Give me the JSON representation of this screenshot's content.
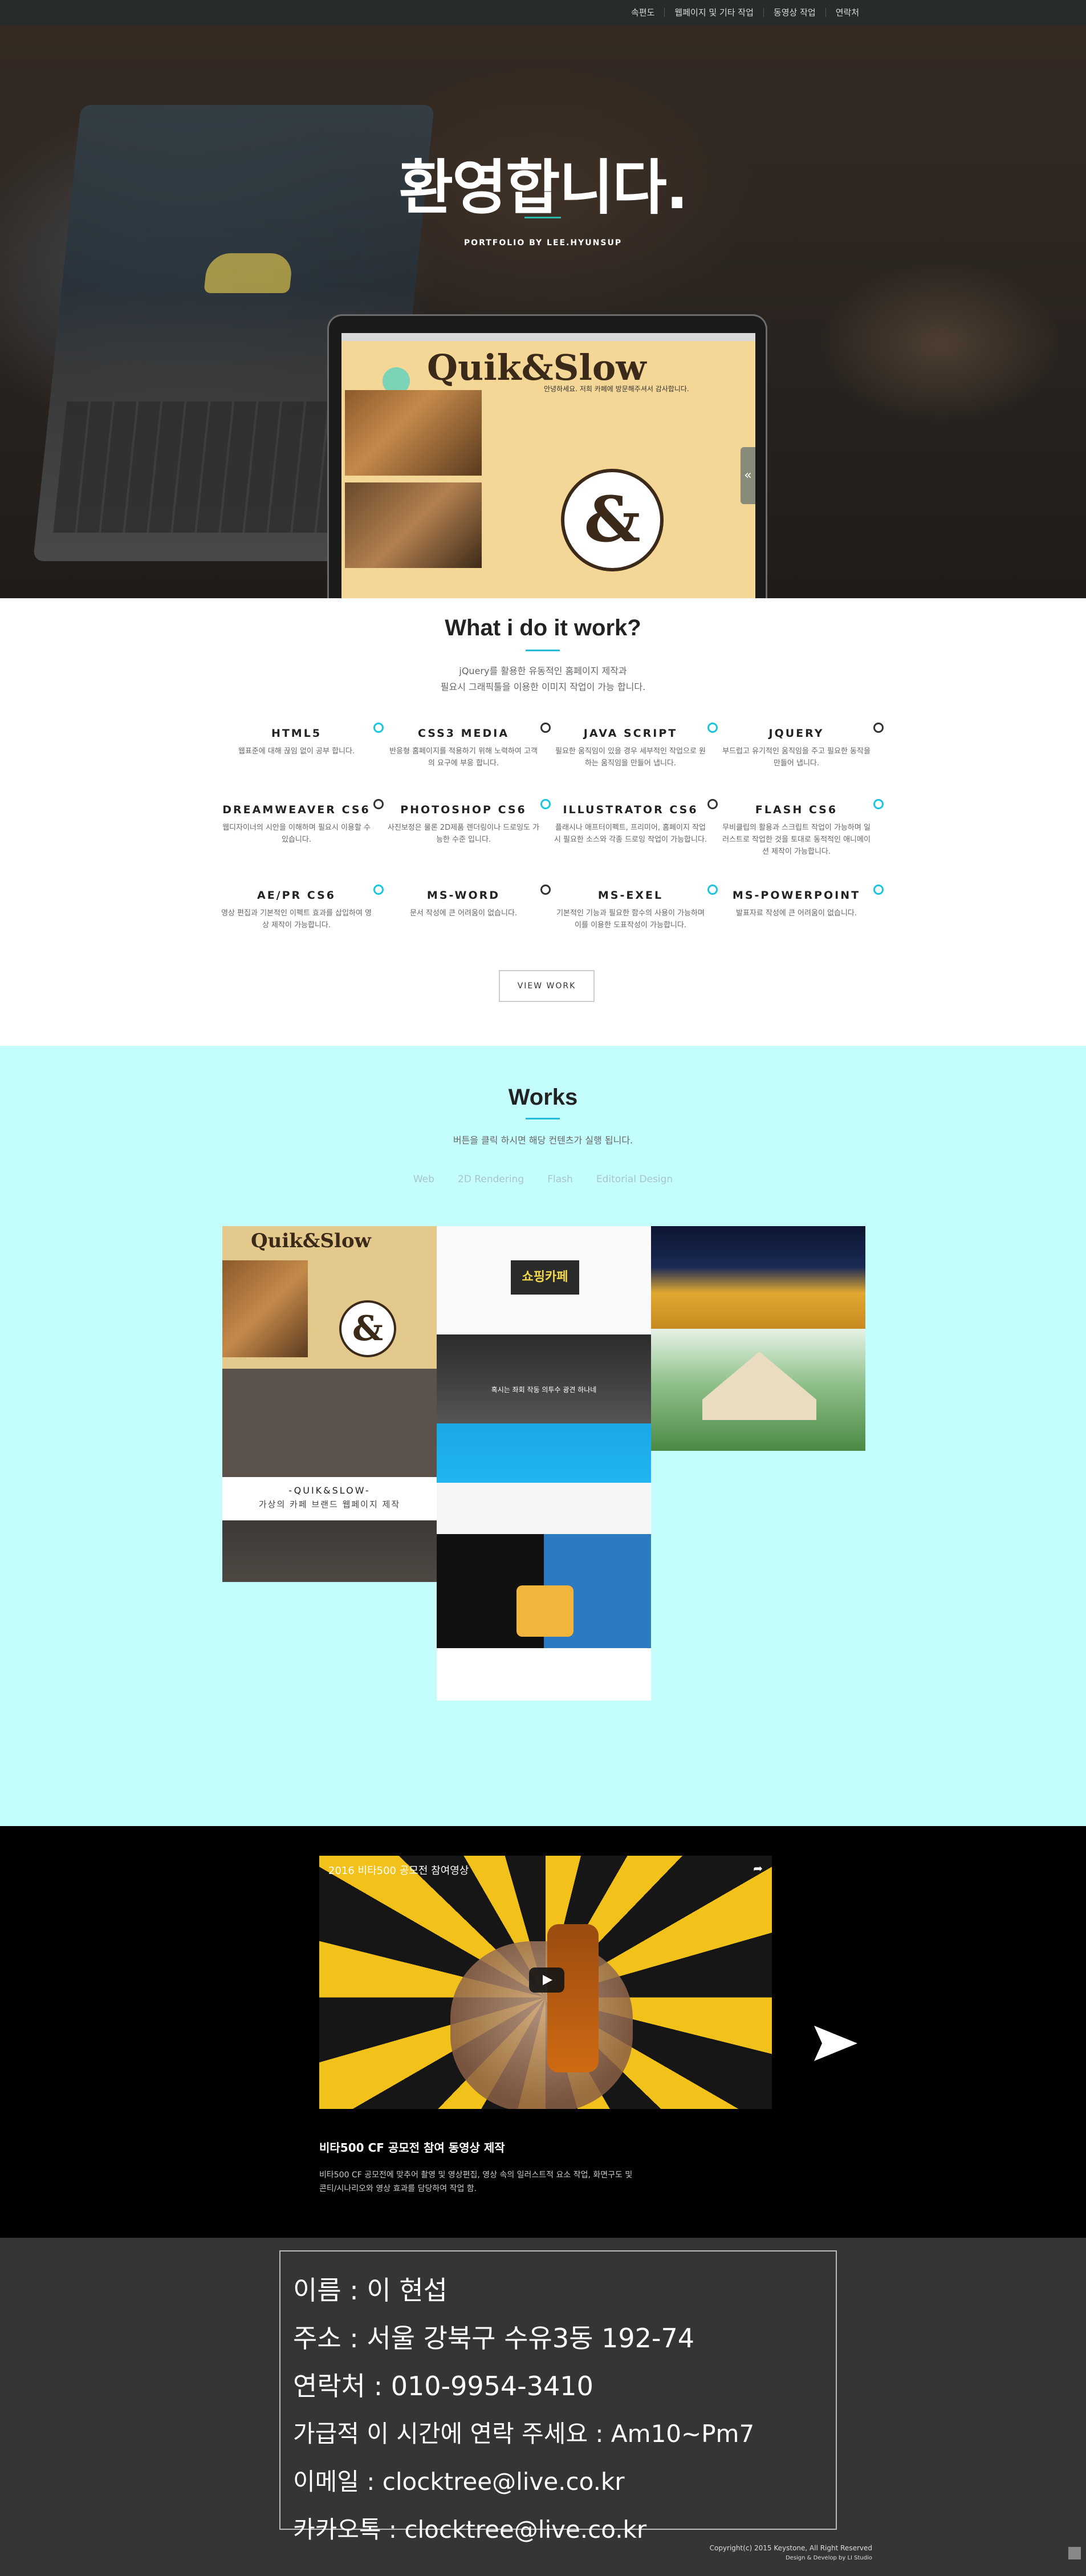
{
  "nav": {
    "items": [
      "속편도",
      "웹페이지 및 기타 작업",
      "동영상 작업",
      "연락처"
    ]
  },
  "hero": {
    "title": "환영합니다.",
    "subtitle": "PORTFOLIO BY LEE.HYUNSUP",
    "mock_logo": "Quik&Slow",
    "mock_text": "안녕하세요. 저희 카페에 방문해주셔서 감사합니다."
  },
  "skills": {
    "title": "What i do it work?",
    "desc_line1": "jQuery를 활용한 유동적인 홈페이지 제작과",
    "desc_line2": "필요시 그래픽툴을 이용한 이미지 작업이 가능 합니다.",
    "items": [
      {
        "name": "HTML5",
        "desc": "웹표준에 대해 끊임 없이 공부 합니다."
      },
      {
        "name": "CSS3 MEDIA",
        "desc": "반응형 홈페이지를 적용하기 위해 노력하여 고객의 요구에 부응 합니다."
      },
      {
        "name": "JAVA SCRIPT",
        "desc": "필요한 움직임이 있을 경우 세부적인 작업으로 원하는 움직임을 만들어 냅니다."
      },
      {
        "name": "JQUERY",
        "desc": "부드럽고 유기적인 움직임을 주고 필요한 동작을 만들어 냅니다."
      },
      {
        "name": "DREAMWEAVER CS6",
        "desc": "웹디자이너의 시안을 이해하며 필요시 이용할 수 있습니다."
      },
      {
        "name": "PHOTOSHOP CS6",
        "desc": "사진보정은 물론 2D제품 렌더링이나 드로잉도 가능한 수준 입니다."
      },
      {
        "name": "ILLUSTRATOR CS6",
        "desc": "플래시나 애프터이펙트, 프리미어, 홈페이지 작업시 필요한 소스와 각종 드로잉 작업이 가능합니다."
      },
      {
        "name": "FLASH CS6",
        "desc": "무비클립의 활용과 스크립트 작업이 가능하며 일러스트로 작업한 것을 토대로 동적적인 애니메이션 제작이 가능합니다."
      },
      {
        "name": "AE/PR CS6",
        "desc": "영상 편집과 기본적인 이펙트 효과를 삽입하여 영상 제작이 가능합니다."
      },
      {
        "name": "MS-WORD",
        "desc": "문서 작성에 큰 어려움이 없습니다."
      },
      {
        "name": "MS-EXEL",
        "desc": "기본적인 기능과 필요한 함수의 사용이 가능하며 이를 이용한 도표작성이 가능합니다."
      },
      {
        "name": "MS-POWERPOINT",
        "desc": "발표자료 작성에 큰 어려움이 없습니다."
      }
    ],
    "button": "VIEW WORK"
  },
  "works": {
    "title": "Works",
    "desc": "버튼을 클릭 하시면 해당 컨텐츠가 실행 됩니다.",
    "filters": [
      "Web",
      "2D Rendering",
      "Flash",
      "Editorial Design"
    ],
    "caption_title": "-QUIK&SLOW-",
    "caption_sub": "가상의 카페 브랜드 웹페이지 제작",
    "thumb_tag": "쇼핑카페",
    "thumb_msg": "혹시는 좌회 작동 의투수 광견 하나네"
  },
  "video": {
    "title": "2016 비타500 공모전 참여영상",
    "caption_title": "비타500 CF 공모전 참여 동영상 제작",
    "caption_desc": "비타500 CF 공모전에 맞추어 촬영 및 영상편집, 영상 속의 일러스트적 요소 작업, 화면구도 및 콘티/시나리오와 영상 효과를 담당하여 작업 함."
  },
  "contact": {
    "name": "이름 : 이 현섭",
    "address": "주소 : 서울 강북구 수유3동 192-74",
    "phone": "연락처 : 010-9954-3410",
    "hours": "가급적 이 시간에 연락 주세요 : Am10~Pm7",
    "email": "이메일 : clocktree@live.co.kr",
    "kakao": "카카오톡 : clocktree@live.co.kr"
  },
  "footer": {
    "copyright": "Copyright(c) 2015 Keystone, All Right Reserved",
    "credit": "Design & Develop by LI Studio"
  },
  "colors": {
    "accent": "#28b9d8",
    "works_bg": "#c3fdfc",
    "footer_bg": "#353535"
  }
}
